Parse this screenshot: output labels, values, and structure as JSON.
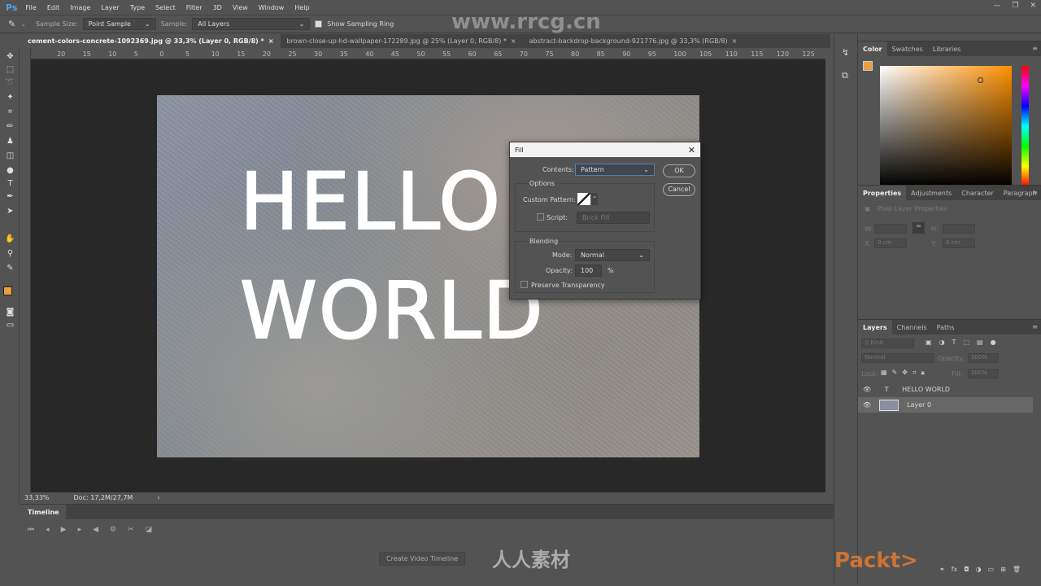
{
  "menubar": {
    "app_logo": "Ps",
    "items": [
      "File",
      "Edit",
      "Image",
      "Layer",
      "Type",
      "Select",
      "Filter",
      "3D",
      "View",
      "Window",
      "Help"
    ]
  },
  "options": {
    "sample_size_label": "Sample Size:",
    "sample_size_value": "Point Sample",
    "sample_label": "Sample:",
    "sample_value": "All Layers",
    "show_ring_label": "Show Sampling Ring",
    "show_ring_checked": true
  },
  "tabs": [
    {
      "label": "cement-colors-concrete-1092369.jpg @ 33,3% (Layer 0, RGB/8) *",
      "active": true
    },
    {
      "label": "brown-close-up-hd-wallpaper-172289.jpg @ 25% (Layer 0, RGB/8) *",
      "active": false
    },
    {
      "label": "abstract-backdrop-background-921776.jpg @ 33,3% (RGB/8)",
      "active": false
    }
  ],
  "ruler_top": [
    "20",
    "15",
    "10",
    "5",
    "0",
    "5",
    "10",
    "15",
    "20",
    "25",
    "30",
    "35",
    "40",
    "45",
    "50",
    "55",
    "60",
    "65",
    "70",
    "75",
    "80",
    "85",
    "90",
    "95",
    "100",
    "105",
    "110",
    "115",
    "120",
    "125"
  ],
  "canvas": {
    "line1": "HELLO",
    "line2": "WORLD"
  },
  "status": {
    "zoom": "33,33%",
    "doc": "Doc: 17,2M/27,7M"
  },
  "timeline": {
    "title": "Timeline",
    "create_button": "Create Video Timeline"
  },
  "color_panel": {
    "tabs": [
      "Color",
      "Swatches",
      "Libraries"
    ],
    "foreground": "#e8a040"
  },
  "properties_panel": {
    "tabs": [
      "Properties",
      "Adjustments",
      "Character",
      "Paragraph"
    ],
    "heading": "Pixel Layer Properties",
    "w_label": "W:",
    "h_label": "H:",
    "x_label": "X:",
    "x_value": "0 cm",
    "y_label": "Y:",
    "y_value": "0 cm"
  },
  "layers_panel": {
    "tabs": [
      "Layers",
      "Channels",
      "Paths"
    ],
    "filter_placeholder": "Kind",
    "blend_mode": "Normal",
    "opacity_label": "Opacity:",
    "opacity_value": "100%",
    "lock_label": "Lock:",
    "fill_label": "Fill:",
    "fill_value": "100%",
    "layers": [
      {
        "name": "HELLO  WORLD",
        "type": "text",
        "selected": false
      },
      {
        "name": "Layer 0",
        "type": "pixel",
        "selected": true
      }
    ]
  },
  "fill_dialog": {
    "title": "Fill",
    "contents_label": "Contents:",
    "contents_value": "Pattern",
    "ok": "OK",
    "cancel": "Cancel",
    "options_label": "Options",
    "custom_pattern_label": "Custom Pattern:",
    "script_label": "Script:",
    "script_value": "Brick Fill",
    "blending_label": "Blending",
    "mode_label": "Mode:",
    "mode_value": "Normal",
    "opacity_label": "Opacity:",
    "opacity_value": "100",
    "percent": "%",
    "preserve_label": "Preserve Transparency"
  },
  "watermarks": {
    "site": "www.rrcg.cn",
    "cn": "人人素材",
    "brand": "Packt>"
  }
}
